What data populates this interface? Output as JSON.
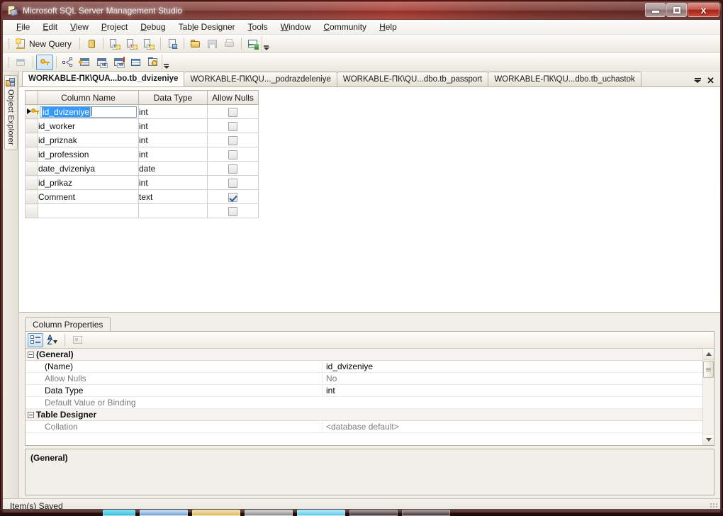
{
  "window": {
    "title": "Microsoft SQL Server Management Studio",
    "app_icon": "sql-server-icon",
    "controls": {
      "minimize": "Minimize",
      "maximize": "Maximize",
      "close": "Close"
    }
  },
  "menu": {
    "items": [
      {
        "label": "File",
        "accel": "F"
      },
      {
        "label": "Edit",
        "accel": "E"
      },
      {
        "label": "View",
        "accel": "V"
      },
      {
        "label": "Project",
        "accel": "P"
      },
      {
        "label": "Debug",
        "accel": "D"
      },
      {
        "label": "Table Designer",
        "accel": "l"
      },
      {
        "label": "Tools",
        "accel": "T"
      },
      {
        "label": "Window",
        "accel": "W"
      },
      {
        "label": "Community",
        "accel": "C"
      },
      {
        "label": "Help",
        "accel": "H"
      }
    ]
  },
  "toolbar_standard": {
    "new_query_label": "New Query",
    "buttons": [
      {
        "name": "new-query-button",
        "icon": "new-query-icon",
        "label": "New Query",
        "enabled": true
      },
      {
        "name": "new-database-engine-query-button",
        "icon": "database-engine-query-icon",
        "label": "",
        "enabled": true
      },
      {
        "name": "new-analysis-services-mdx-query-button",
        "icon": "mdx-query-icon",
        "label": "MDX",
        "enabled": true
      },
      {
        "name": "new-analysis-services-dmx-query-button",
        "icon": "dmx-query-icon",
        "label": "DMX",
        "enabled": true
      },
      {
        "name": "new-analysis-services-xmla-query-button",
        "icon": "xmla-query-icon",
        "label": "XMLA",
        "enabled": true
      },
      {
        "name": "new-sql-server-compact-query-button",
        "icon": "compact-query-icon",
        "label": "",
        "enabled": true
      },
      {
        "name": "open-file-button",
        "icon": "open-folder-icon",
        "label": "",
        "enabled": true
      },
      {
        "name": "save-button",
        "icon": "save-icon",
        "label": "",
        "enabled": false
      },
      {
        "name": "print-button",
        "icon": "printer-icon",
        "label": "",
        "enabled": false
      },
      {
        "name": "activity-monitor-button",
        "icon": "activity-monitor-icon",
        "label": "",
        "enabled": true
      }
    ],
    "overflow": "Toolbar Options"
  },
  "toolbar_table_designer": {
    "buttons": [
      {
        "name": "set-primary-key-table-button",
        "icon": "table-icon",
        "enabled": false,
        "active": false
      },
      {
        "name": "set-primary-key-button",
        "icon": "key-icon",
        "enabled": true,
        "active": true
      },
      {
        "name": "relationships-button",
        "icon": "relationships-icon",
        "enabled": true,
        "active": false
      },
      {
        "name": "manage-indexes-and-keys-button",
        "icon": "index-key-icon",
        "enabled": true,
        "active": false
      },
      {
        "name": "manage-check-constraints-button",
        "icon": "check-constraint-icon",
        "enabled": true,
        "active": false
      },
      {
        "name": "manage-xml-indexes-button",
        "icon": "xml-index-icon",
        "enabled": true,
        "active": false
      },
      {
        "name": "manage-fulltext-index-button",
        "icon": "fulltext-index-icon",
        "enabled": true,
        "active": false
      },
      {
        "name": "generate-change-script-button",
        "icon": "change-script-icon",
        "enabled": true,
        "active": false
      }
    ],
    "overflow": "Toolbar Options"
  },
  "left_dock": {
    "object_explorer_label": "Object Explorer",
    "icon": "object-explorer-icon"
  },
  "document_tabs": {
    "tabs": [
      {
        "label": "WORKABLE-ПК\\QUA...bo.tb_dvizeniye",
        "active": true
      },
      {
        "label": "WORKABLE-ПК\\QU..._podrazdeleniye",
        "active": false
      },
      {
        "label": "WORKABLE-ПК\\QU...dbo.tb_passport",
        "active": false
      },
      {
        "label": "WORKABLE-ПК\\QU...dbo.tb_uchastok",
        "active": false
      }
    ],
    "actions": {
      "active_files_label": "Active Files",
      "close_label": "Close"
    }
  },
  "designer": {
    "headers": {
      "selector": "",
      "column_name": "Column Name",
      "data_type": "Data Type",
      "allow_nulls": "Allow Nulls"
    },
    "rows": [
      {
        "name": "id_dvizeniye",
        "data_type": "int",
        "allow_nulls": false,
        "primary_key": true,
        "selected": true,
        "editing": true
      },
      {
        "name": "id_worker",
        "data_type": "int",
        "allow_nulls": false,
        "primary_key": false,
        "selected": false,
        "editing": false
      },
      {
        "name": "id_priznak",
        "data_type": "int",
        "allow_nulls": false,
        "primary_key": false,
        "selected": false,
        "editing": false
      },
      {
        "name": "id_profession",
        "data_type": "int",
        "allow_nulls": false,
        "primary_key": false,
        "selected": false,
        "editing": false
      },
      {
        "name": "date_dvizeniya",
        "data_type": "date",
        "allow_nulls": false,
        "primary_key": false,
        "selected": false,
        "editing": false
      },
      {
        "name": "id_prikaz",
        "data_type": "int",
        "allow_nulls": false,
        "primary_key": false,
        "selected": false,
        "editing": false
      },
      {
        "name": "Comment",
        "data_type": "text",
        "allow_nulls": true,
        "primary_key": false,
        "selected": false,
        "editing": false
      },
      {
        "name": "",
        "data_type": "",
        "allow_nulls": false,
        "primary_key": false,
        "selected": false,
        "editing": false
      }
    ]
  },
  "properties": {
    "tab_label": "Column Properties",
    "toolbar": [
      {
        "name": "categorized-button",
        "icon": "categorized-icon",
        "active": true,
        "enabled": true
      },
      {
        "name": "alphabetical-button",
        "icon": "sort-az-icon",
        "active": false,
        "enabled": true
      },
      {
        "name": "property-pages-button",
        "icon": "property-pages-icon",
        "active": false,
        "enabled": false
      }
    ],
    "rows": [
      {
        "type": "category",
        "name": "(General)",
        "value": "",
        "expanded": true
      },
      {
        "type": "property",
        "name": "(Name)",
        "value": "id_dvizeniye",
        "dim_name": false,
        "dim_value": false
      },
      {
        "type": "property",
        "name": "Allow Nulls",
        "value": "No",
        "dim_name": true,
        "dim_value": true
      },
      {
        "type": "property",
        "name": "Data Type",
        "value": "int",
        "dim_name": false,
        "dim_value": false
      },
      {
        "type": "property",
        "name": "Default Value or Binding",
        "value": "",
        "dim_name": true,
        "dim_value": true
      },
      {
        "type": "category",
        "name": "Table Designer",
        "value": "",
        "expanded": true
      },
      {
        "type": "property",
        "name": "Collation",
        "value": "<database default>",
        "dim_name": true,
        "dim_value": true
      }
    ],
    "description_title": "(General)",
    "scrollbar": {
      "up": "Scroll up",
      "down": "Scroll down",
      "thumb": "Scroll thumb"
    }
  },
  "statusbar": {
    "message": "Item(s) Saved"
  }
}
